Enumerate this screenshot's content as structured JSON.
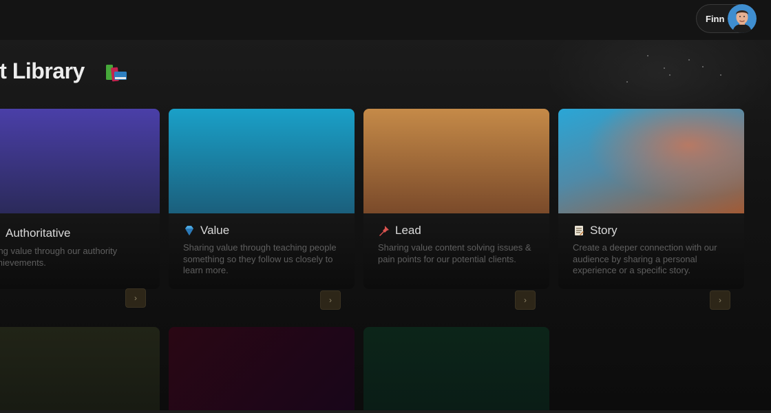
{
  "header": {
    "user_name": "Finn",
    "avatar_icon": "avatar-photo"
  },
  "page": {
    "title": "st Library",
    "title_icon": "books-icon"
  },
  "cards": [
    {
      "title": "Authoritative",
      "icon": "none-visible",
      "description": "aring value through our authority achievements.",
      "image_colors": [
        "#4a3fa8",
        "#2b2a5a"
      ]
    },
    {
      "title": "Value",
      "icon": "gem-icon",
      "description": "Sharing value through teaching people something so they follow us closely to learn more.",
      "image_colors": [
        "#1aa0c8",
        "#1b5f7c"
      ]
    },
    {
      "title": "Lead",
      "icon": "pushpin-icon",
      "description": "Sharing value content solving issues & pain points for our potential clients.",
      "image_colors": [
        "#c58a48",
        "#7a4a2a"
      ]
    },
    {
      "title": "Story",
      "icon": "memo-icon",
      "description": "Create a deeper connection with our audience by sharing a personal experience or a specific story.",
      "image_colors": [
        "#2aa6d6",
        "#b77964"
      ]
    }
  ],
  "row2_cards": [
    {
      "colors": [
        "#212417",
        "#171a12"
      ]
    },
    {
      "colors": [
        "#2a0714",
        "#18061a"
      ]
    },
    {
      "colors": [
        "#0c2519",
        "#0a1c16"
      ]
    }
  ],
  "arrow_label": "›"
}
